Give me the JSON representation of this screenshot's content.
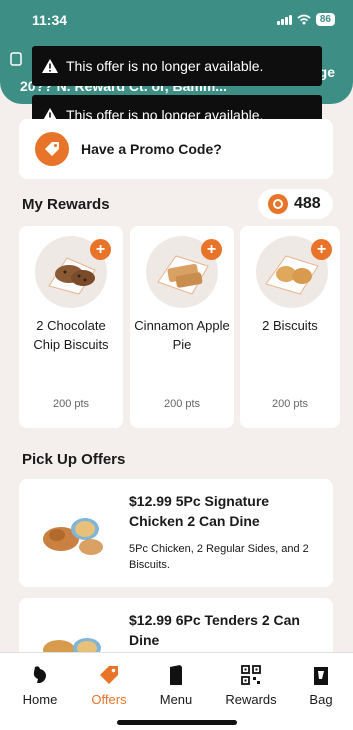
{
  "status_bar": {
    "time": "11:34",
    "battery": "86"
  },
  "header": {
    "address": "20?? N. Reward Ct. or, Bamm...",
    "action_label": "ge"
  },
  "toasts": [
    {
      "message": "This offer is no longer available."
    },
    {
      "message": "This offer is no longer available."
    }
  ],
  "promo": {
    "label": "Have a Promo Code?"
  },
  "rewards": {
    "title": "My Rewards",
    "points": "488",
    "items": [
      {
        "name": "2 Chocolate Chip Biscuits",
        "points": "200 pts"
      },
      {
        "name": "Cinnamon Apple Pie",
        "points": "200 pts"
      },
      {
        "name": "2 Biscuits",
        "points": "200 pts"
      }
    ]
  },
  "offers": {
    "title": "Pick Up Offers",
    "items": [
      {
        "title": "$12.99 5Pc Signature Chicken 2 Can Dine",
        "description": "5Pc Chicken, 2 Regular Sides, and 2 Biscuits."
      },
      {
        "title": "$12.99 6Pc Tenders 2 Can Dine",
        "description": ""
      }
    ]
  },
  "tabbar": {
    "items": [
      {
        "label": "Home",
        "icon": "chicken-icon"
      },
      {
        "label": "Offers",
        "icon": "tag-icon"
      },
      {
        "label": "Menu",
        "icon": "menu-box-icon"
      },
      {
        "label": "Rewards",
        "icon": "qr-code-icon"
      },
      {
        "label": "Bag",
        "icon": "bag-icon"
      }
    ],
    "active": "Offers"
  },
  "colors": {
    "header": "#3d8f86",
    "accent": "#e8742a",
    "background": "#f4efec"
  }
}
